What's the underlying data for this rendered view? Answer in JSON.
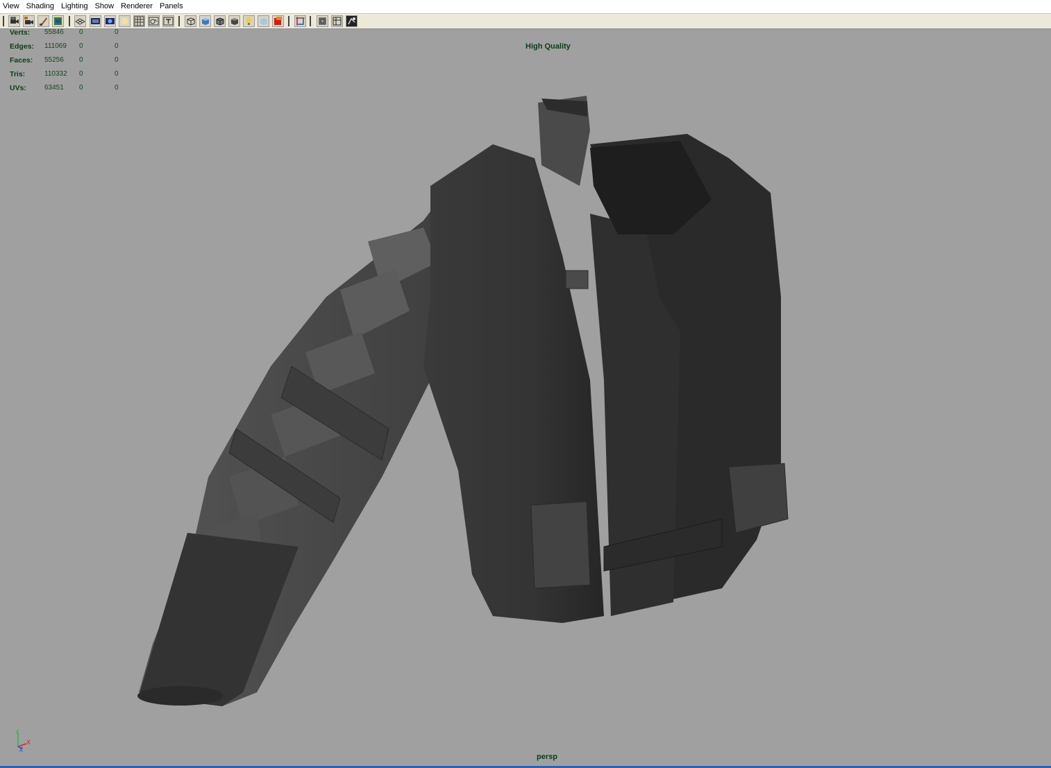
{
  "menu": {
    "items": [
      "View",
      "Shading",
      "Lighting",
      "Show",
      "Renderer",
      "Panels"
    ]
  },
  "toolbar": {
    "icons": [
      "select-camera-icon",
      "lock-camera-icon",
      "camera-attributes-icon",
      "bookmark-icon",
      "grid-icon",
      "film-gate-icon",
      "resolution-gate-icon",
      "gate-mask-icon",
      "field-chart-icon",
      "safe-action-icon",
      "safe-title-icon",
      "wireframe-icon",
      "smooth-shade-icon",
      "wireframe-on-shaded-icon",
      "flat-shade-icon",
      "default-lighting-icon",
      "textured-icon",
      "shadows-icon",
      "isolate-select-icon",
      "xray-icon",
      "xray-joints-icon",
      "high-quality-icon"
    ]
  },
  "hud": {
    "rows": [
      {
        "label": "Verts:",
        "values": [
          "55846",
          "0",
          "0"
        ]
      },
      {
        "label": "Edges:",
        "values": [
          "111069",
          "0",
          "0"
        ]
      },
      {
        "label": "Faces:",
        "values": [
          "55256",
          "0",
          "0"
        ]
      },
      {
        "label": "Tris:",
        "values": [
          "110332",
          "0",
          "0"
        ]
      },
      {
        "label": "UVs:",
        "values": [
          "63451",
          "0",
          "0"
        ]
      }
    ]
  },
  "viewport": {
    "quality_label": "High Quality",
    "camera_name": "persp",
    "background_color": "#a0a0a0"
  },
  "axis": {
    "y_label": "Y",
    "x_label": "X",
    "z_label": "Z"
  }
}
